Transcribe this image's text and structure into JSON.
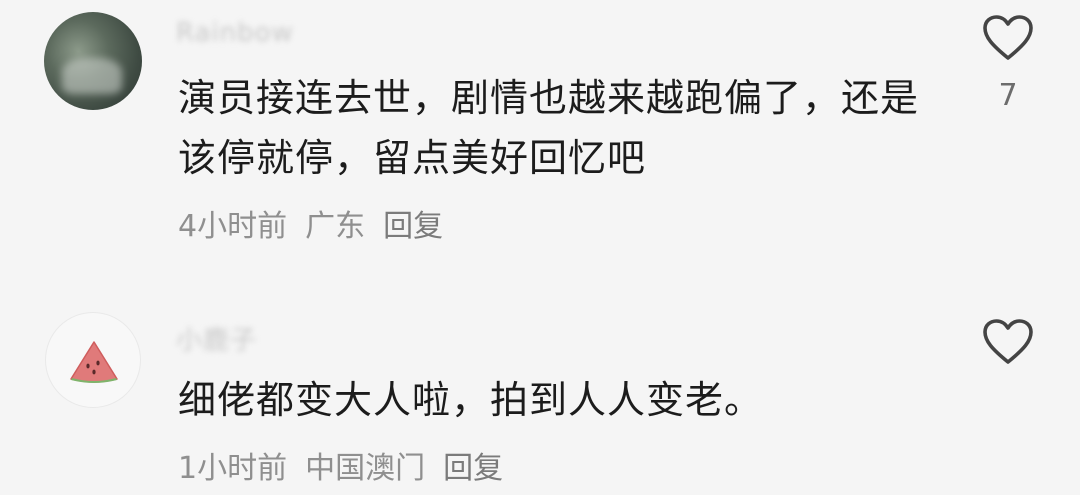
{
  "comments": [
    {
      "username": "Rainbow",
      "text_line1": "演员接连去世，剧情也越来越跑偏了，还是",
      "text_line2": "该停就停，留点美好回忆吧",
      "time": "4小时前",
      "location": "广东",
      "reply_label": "回复",
      "likes": "7",
      "avatar_icon": "photo-avatar"
    },
    {
      "username": "小鹿子",
      "text_line1": "细佬都变大人啦，拍到人人变老。",
      "time": "1小时前",
      "location": "中国澳门",
      "reply_label": "回复",
      "likes": "",
      "avatar_icon": "watermelon-icon"
    }
  ],
  "colors": {
    "background": "#f5f5f5",
    "text": "#1c1c1c",
    "meta": "#8f8f8f",
    "heart_outline": "#444444"
  },
  "icons": {
    "like": "heart-outline-icon"
  }
}
